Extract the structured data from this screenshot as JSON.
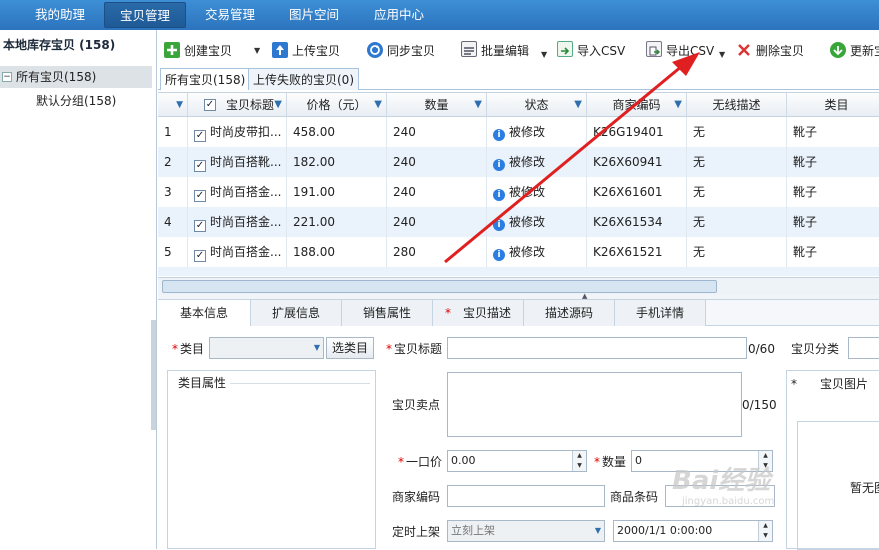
{
  "topnav": {
    "items": [
      {
        "label": "我的助理"
      },
      {
        "label": "宝贝管理"
      },
      {
        "label": "交易管理"
      },
      {
        "label": "图片空间"
      },
      {
        "label": "应用中心"
      }
    ]
  },
  "sidebar": {
    "title": "本地库存宝贝 (158)",
    "tree": {
      "root": {
        "label": "所有宝贝(158)",
        "expander": "−"
      },
      "child": {
        "label": "默认分组(158)"
      }
    }
  },
  "toolbar": {
    "create": "创建宝贝",
    "upload": "上传宝贝",
    "sync": "同步宝贝",
    "batch_edit": "批量编辑",
    "import_csv": "导入CSV",
    "export_csv": "导出CSV",
    "delete": "删除宝贝",
    "update": "更新宝"
  },
  "list_tabs": {
    "all": "所有宝贝(158)",
    "failed": "上传失败的宝贝(0)"
  },
  "grid": {
    "columns": {
      "title": "宝贝标题",
      "price": "价格（元）",
      "qty": "数量",
      "status": "状态",
      "code": "商家编码",
      "wireless": "无线描述",
      "category": "类目"
    },
    "rows": [
      {
        "num": "1",
        "title": "时尚皮带扣...",
        "price": "458.00",
        "qty": "240",
        "status": "被修改",
        "code": "K26G19401",
        "wireless": "无",
        "category": "靴子"
      },
      {
        "num": "2",
        "title": "时尚百搭靴...",
        "price": "182.00",
        "qty": "240",
        "status": "被修改",
        "code": "K26X60941",
        "wireless": "无",
        "category": "靴子"
      },
      {
        "num": "3",
        "title": "时尚百搭金...",
        "price": "191.00",
        "qty": "240",
        "status": "被修改",
        "code": "K26X61601",
        "wireless": "无",
        "category": "靴子"
      },
      {
        "num": "4",
        "title": "时尚百搭金...",
        "price": "221.00",
        "qty": "240",
        "status": "被修改",
        "code": "K26X61534",
        "wireless": "无",
        "category": "靴子"
      },
      {
        "num": "5",
        "title": "时尚百搭金...",
        "price": "188.00",
        "qty": "280",
        "status": "被修改",
        "code": "K26X61521",
        "wireless": "无",
        "category": "靴子"
      }
    ]
  },
  "detail_tabs": {
    "basic": "基本信息",
    "extended": "扩展信息",
    "sales": "销售属性",
    "desc_marker": "*",
    "desc": "宝贝描述",
    "source": "描述源码",
    "mobile": "手机详情"
  },
  "form": {
    "req_mark": "*",
    "category_label": "类目",
    "choose_category": "选类目",
    "title_label": "宝贝标题",
    "title_count": "0/60",
    "group_label": "宝贝分类",
    "attrs_label": "类目属性",
    "selling_label": "宝贝卖点",
    "selling_count": "0/150",
    "pic_marker": "*",
    "pic_label": "宝贝图片",
    "pic_empty": "暂无图",
    "price_label": "一口价",
    "price_value": "0.00",
    "qty_label": "数量",
    "qty_value": "0",
    "code_label": "商家编码",
    "barcode_label": "商品条码",
    "schedule_label": "定时上架",
    "schedule_value": "立刻上架",
    "date_value": "2000/1/1 0:00:00"
  },
  "watermark": {
    "text": "Bai经验",
    "sub": "jingyan.baidu.com"
  },
  "colors": {
    "nav": "#2c74bd",
    "arrow": "#e02020",
    "row_alt": "#eaf2fb"
  }
}
